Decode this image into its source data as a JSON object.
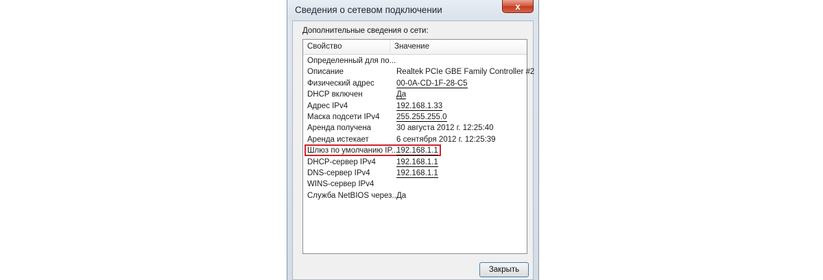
{
  "window": {
    "title": "Сведения о сетевом подключении",
    "close_glyph": "x"
  },
  "group_label": "Дополнительные сведения о сети:",
  "list": {
    "columns": [
      "Свойство",
      "Значение"
    ],
    "rows": [
      {
        "property": "Определенный для по...",
        "value": ""
      },
      {
        "property": "Описание",
        "value": "Realtek PCIe GBE Family Controller #2"
      },
      {
        "property": "Физический адрес",
        "value": "00-0A-CD-1F-28-C5"
      },
      {
        "property": "DHCP включен",
        "value": "Да"
      },
      {
        "property": "Адрес IPv4",
        "value": "192.168.1.33"
      },
      {
        "property": "Маска подсети IPv4",
        "value": "255.255.255.0"
      },
      {
        "property": "Аренда получена",
        "value": "30 августа 2012 г. 12:25:40"
      },
      {
        "property": "Аренда истекает",
        "value": "6 сентября 2012 г. 12:25:39"
      },
      {
        "property": "Шлюз по умолчанию IP...",
        "value": "192.168.1.1"
      },
      {
        "property": "DHCP-сервер IPv4",
        "value": "192.168.1.1"
      },
      {
        "property": "DNS-сервер IPv4",
        "value": "192.168.1.1"
      },
      {
        "property": "WINS-сервер IPv4",
        "value": ""
      },
      {
        "property": "Служба NetBIOS через...",
        "value": "Да"
      }
    ]
  },
  "buttons": {
    "close_label": "Закрыть"
  },
  "colors": {
    "highlight": "#d0202a",
    "close_button_red": "#c43b21",
    "focus_border": "#3c7fb1"
  }
}
